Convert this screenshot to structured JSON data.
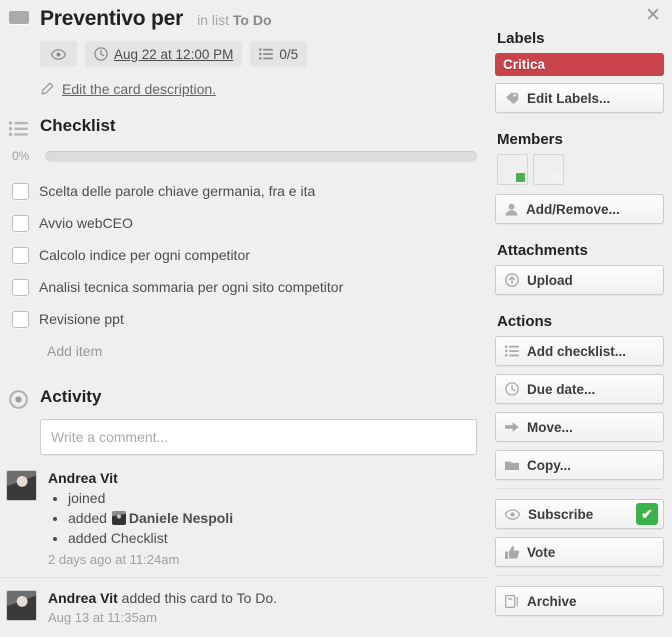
{
  "window": {
    "close_label": "✕"
  },
  "card": {
    "title": "Preventivo per",
    "in_list_prefix": "in list",
    "list_name": "To Do",
    "badges": {
      "watch_icon": "eye-icon",
      "due_icon": "clock-icon",
      "due_text": "Aug 22 at 12:00 PM",
      "checklist_icon": "checklist-icon",
      "checklist_count": "0/5"
    },
    "description_link": "Edit the card description.",
    "description_icon": "pencil-icon"
  },
  "checklist": {
    "icon": "list-icon",
    "title": "Checklist",
    "progress_percent": "0%",
    "progress_value": 0,
    "items": [
      {
        "text": "Scelta delle parole chiave germania, fra e ita",
        "checked": false
      },
      {
        "text": "Avvio webCEO",
        "checked": false
      },
      {
        "text": "Calcolo indice per ogni competitor",
        "checked": false
      },
      {
        "text": "Analisi tecnica sommaria per ogni sito competitor",
        "checked": false
      },
      {
        "text": "Revisione ppt",
        "checked": false
      }
    ],
    "add_item_label": "Add item"
  },
  "activity": {
    "icon": "activity-icon",
    "title": "Activity",
    "comment_placeholder": "Write a comment...",
    "comment_value": "",
    "entries": [
      {
        "author": "Andrea Vit",
        "bullets": [
          {
            "prefix": "joined",
            "avatar": false,
            "bold": ""
          },
          {
            "prefix": "added",
            "avatar": true,
            "bold": "Daniele Nespoli"
          },
          {
            "prefix": "added Checklist",
            "avatar": false,
            "bold": ""
          }
        ],
        "timestamp": "2 days ago at 11:24am"
      },
      {
        "author": "Andrea Vit",
        "action_text": " added this card to To Do.",
        "bullets": [],
        "timestamp": "Aug 13 at 11:35am"
      }
    ]
  },
  "sidebar": {
    "labels": {
      "heading": "Labels",
      "chips": [
        {
          "text": "Critica",
          "color": "#c9444a"
        }
      ],
      "edit_button": {
        "label": "Edit Labels...",
        "icon": "tag-icon"
      }
    },
    "members": {
      "heading": "Members",
      "avatars": [
        {
          "name": "Andrea Vit",
          "status_color": "#4caf50"
        },
        {
          "name": "Daniele Nespoli",
          "status_color": "#f2f2f2"
        }
      ],
      "add_remove_button": {
        "label": "Add/Remove...",
        "icon": "person-icon"
      }
    },
    "attachments": {
      "heading": "Attachments",
      "upload_button": {
        "label": "Upload",
        "icon": "upload-icon"
      }
    },
    "actions": {
      "heading": "Actions",
      "buttons": [
        {
          "label": "Add checklist...",
          "icon": "checklist-icon"
        },
        {
          "label": "Due date...",
          "icon": "clock-icon"
        },
        {
          "label": "Move...",
          "icon": "arrow-right-icon"
        },
        {
          "label": "Copy...",
          "icon": "card-icon"
        },
        {
          "label": "Subscribe",
          "icon": "eye-icon",
          "checked": true,
          "check_glyph": "✔"
        },
        {
          "label": "Vote",
          "icon": "thumbs-up-icon"
        },
        {
          "label": "Archive",
          "icon": "archive-icon"
        }
      ]
    }
  }
}
